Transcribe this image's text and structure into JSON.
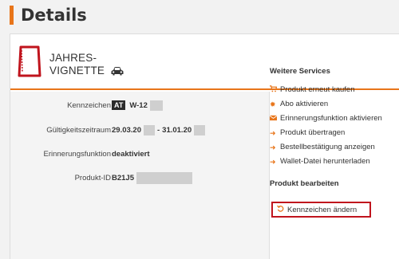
{
  "page": {
    "title": "Details"
  },
  "product": {
    "name_line1": "JAHRES-",
    "name_line2": "VIGNETTE",
    "vehicle_icon": "car-icon",
    "brand_color": "#c0141d"
  },
  "details": {
    "plate": {
      "label": "Kennzeichen",
      "country": "AT",
      "value": "W-12"
    },
    "validity": {
      "label": "Gültigkeitszeitraum",
      "start": "29.03.20",
      "separator": "-",
      "end": "31.01.20"
    },
    "reminder": {
      "label": "Erinnerungsfunktion",
      "value": "deaktiviert"
    },
    "product_id": {
      "label": "Produkt-ID",
      "value": "B21J5"
    }
  },
  "services": {
    "title": "Weitere Services",
    "items": [
      {
        "icon": "cart-icon",
        "label": "Produkt erneut kaufen"
      },
      {
        "icon": "gear-icon",
        "label": "Abo aktivieren"
      },
      {
        "icon": "envelope-icon",
        "label": "Erinnerungsfunktion aktivieren"
      },
      {
        "icon": "arrow-right-icon",
        "label": "Produkt übertragen"
      },
      {
        "icon": "arrow-right-icon",
        "label": "Bestellbestätigung anzeigen"
      },
      {
        "icon": "arrow-right-icon",
        "label": "Wallet-Datei herunterladen"
      }
    ]
  },
  "edit": {
    "title": "Produkt bearbeiten",
    "button_label": "Kennzeichen ändern",
    "button_icon": "undo-icon",
    "highlight_color": "#c0141d"
  },
  "colors": {
    "accent": "#e8751a",
    "text": "#333333"
  }
}
